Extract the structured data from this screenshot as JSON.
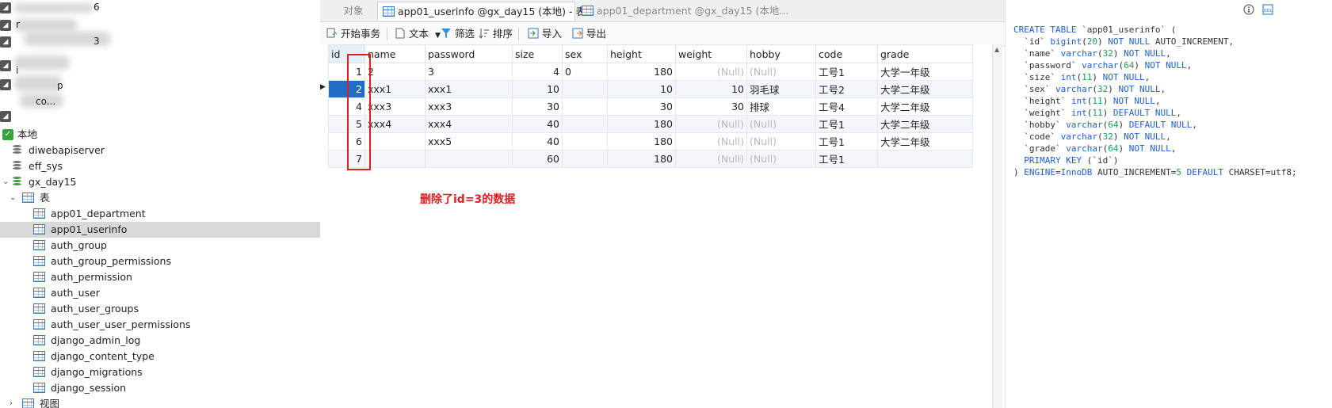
{
  "tabs": {
    "objects": "对象",
    "active": "app01_userinfo @gx_day15 (本地) - 表",
    "inactive": "app01_department @gx_day15 (本地..."
  },
  "toolbar": {
    "begin_transaction": "开始事务",
    "text": "文本",
    "filter": "筛选",
    "sort": "排序",
    "import": "导入",
    "export": "导出"
  },
  "sidebar": {
    "partial_labels": [
      "6",
      "r",
      "3",
      "i",
      "p",
      "co..."
    ],
    "connection": "本地",
    "databases": [
      "diwebapiserver",
      "eff_sys",
      "gx_day15"
    ],
    "tables_node": "表",
    "tables": [
      "app01_department",
      "app01_userinfo",
      "auth_group",
      "auth_group_permissions",
      "auth_permission",
      "auth_user",
      "auth_user_groups",
      "auth_user_user_permissions",
      "django_admin_log",
      "django_content_type",
      "django_migrations",
      "django_session"
    ],
    "views_node": "视图"
  },
  "grid": {
    "columns": [
      "id",
      "name",
      "password",
      "size",
      "sex",
      "height",
      "weight",
      "hobby",
      "code",
      "grade"
    ],
    "rows": [
      [
        "1",
        "2",
        "3",
        "4",
        "0",
        "180",
        "(Null)",
        "(Null)",
        "工号1",
        "大学一年级"
      ],
      [
        "2",
        "xxx1",
        "xxx1",
        "10",
        "",
        "10",
        "10",
        "羽毛球",
        "工号2",
        "大学二年级"
      ],
      [
        "4",
        "xxx3",
        "xxx3",
        "30",
        "",
        "30",
        "30",
        "排球",
        "工号4",
        "大学二年级"
      ],
      [
        "5",
        "xxx4",
        "xxx4",
        "40",
        "",
        "180",
        "(Null)",
        "(Null)",
        "工号1",
        "大学二年级"
      ],
      [
        "6",
        "",
        "xxx5",
        "40",
        "",
        "180",
        "(Null)",
        "(Null)",
        "工号1",
        "大学二年级"
      ],
      [
        "7",
        "",
        "",
        "60",
        "",
        "180",
        "(Null)",
        "(Null)",
        "工号1",
        ""
      ]
    ],
    "selected_row": 1
  },
  "annotation": "删除了id=3的数据",
  "ddl": {
    "line1": "CREATE TABLE `app01_userinfo` (",
    "lines": [
      "  `id` bigint(20) NOT NULL AUTO_INCREMENT,",
      "  `name` varchar(32) NOT NULL,",
      "  `password` varchar(64) NOT NULL,",
      "  `size` int(11) NOT NULL,",
      "  `sex` varchar(32) NOT NULL,",
      "  `height` int(11) NOT NULL,",
      "  `weight` int(11) DEFAULT NULL,",
      "  `hobby` varchar(64) DEFAULT NULL,",
      "  `code` varchar(32) NOT NULL,",
      "  `grade` varchar(64) NOT NULL,",
      "  PRIMARY KEY (`id`)",
      ") ENGINE=InnoDB AUTO_INCREMENT=5 DEFAULT CHARSET=utf8;"
    ]
  },
  "colors": {
    "accent": "#1f6fc6",
    "annotation": "#e02020",
    "db_active": "#3aa23a"
  }
}
